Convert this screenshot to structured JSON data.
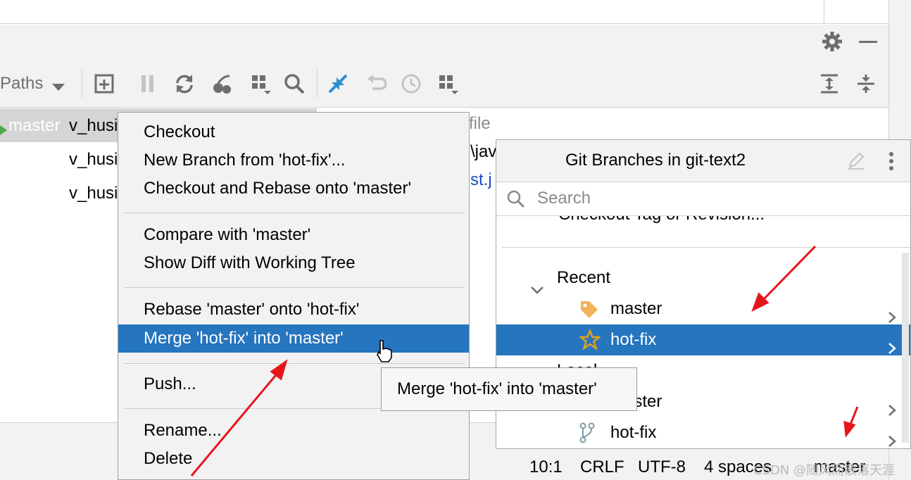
{
  "toolbar": {
    "paths_label": "Paths"
  },
  "git_log": {
    "rows": [
      {
        "branch_tag": "master",
        "text": "v_husi"
      },
      {
        "branch_tag": "",
        "text": "v_husi"
      },
      {
        "branch_tag": "",
        "text": "v_husi"
      }
    ]
  },
  "commit_details": {
    "line1": "file",
    "line2": "\\jav",
    "line3": "st.j"
  },
  "context_menu": {
    "items": [
      "Checkout",
      "New Branch from 'hot-fix'...",
      "Checkout and Rebase onto 'master'",
      "Compare with 'master'",
      "Show Diff with Working Tree",
      "Rebase 'master' onto 'hot-fix'",
      "Merge 'hot-fix' into 'master'",
      "Push...",
      "Rename...",
      "Delete"
    ]
  },
  "tooltip": {
    "text": "Merge 'hot-fix' into 'master'"
  },
  "git_branches": {
    "title": "Git Branches in git-text2",
    "search_placeholder": "Search",
    "partial_action": "Checkout Tag or Revision...",
    "recent_group": "Recent",
    "recent": [
      "master",
      "hot-fix"
    ],
    "local_group": "Local",
    "local": [
      "master",
      "hot-fix"
    ]
  },
  "status_bar": {
    "position": "10:1",
    "line_separator": "CRLF",
    "encoding": "UTF-8",
    "indent": "4 spaces",
    "branch": "master"
  },
  "watermark": "CSDN @随风而散落天涯",
  "colors": {
    "selection": "#2675bf",
    "arrow": "#e8141a",
    "star": "#e2a21a",
    "tag": "#f3b35a",
    "link": "#1a4ec2"
  }
}
